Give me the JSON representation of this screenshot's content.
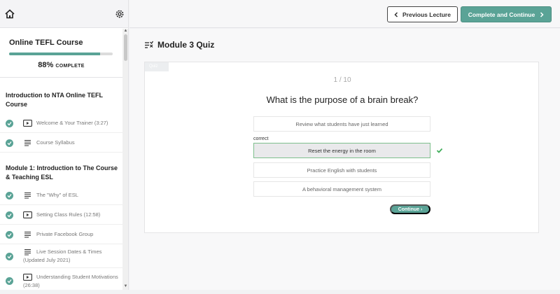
{
  "sidebar": {
    "course_title": "Online TEFL Course",
    "progress_percent": 88,
    "progress_value": "88%",
    "progress_label": "COMPLETE",
    "sections": [
      {
        "title": "Introduction to NTA Online TEFL Course",
        "lessons": [
          {
            "label": "Welcome & Your Trainer (3:27)",
            "type": "video-icon",
            "completed": true
          },
          {
            "label": "Course Syllabus",
            "type": "text-icon",
            "completed": true
          }
        ]
      },
      {
        "title": "Module 1: Introduction to The Course & Teaching ESL",
        "lessons": [
          {
            "label": "The \"Why\" of ESL",
            "type": "text-icon",
            "completed": true
          },
          {
            "label": "Setting Class Rules (12:58)",
            "type": "video-icon",
            "completed": true
          },
          {
            "label": "Private Facebook Group",
            "type": "text-icon",
            "completed": true
          },
          {
            "label": "Live Session Dates & Times",
            "label2": "(Updated July 2021)",
            "type": "text-icon",
            "completed": true
          },
          {
            "label": "Understanding Student Motivations",
            "label2": "(26:38)",
            "type": "video-icon",
            "completed": true
          }
        ]
      }
    ]
  },
  "header": {
    "prev_label": "Previous Lecture",
    "next_label": "Complete and Continue"
  },
  "main": {
    "title": "Module 3 Quiz",
    "tag": "Quiz",
    "counter": "1 / 10",
    "question": "What is the purpose of a brain break?",
    "correct_label": "correct",
    "answers": [
      "Review what students have just learned",
      "Reset the energy in the room",
      "Practice English with students",
      "A behavioral management system"
    ],
    "selected_index": 1,
    "continue_label": "Continue ›"
  },
  "colors": {
    "accent": "#5aa396",
    "correct_border": "#7dbf8c",
    "tick": "#3fae5a"
  }
}
